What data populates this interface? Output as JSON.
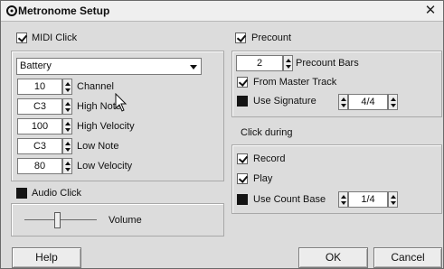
{
  "window": {
    "title": "Metronome Setup",
    "close_glyph": "✕"
  },
  "midi_click": {
    "label": "MIDI Click",
    "checked": true,
    "instrument": "Battery",
    "fields": [
      {
        "value": "10",
        "label": "Channel"
      },
      {
        "value": "C3",
        "label": "High Note"
      },
      {
        "value": "100",
        "label": "High Velocity"
      },
      {
        "value": "C3",
        "label": "Low Note"
      },
      {
        "value": "80",
        "label": "Low Velocity"
      }
    ]
  },
  "audio_click": {
    "label": "Audio Click",
    "checked": false,
    "volume_label": "Volume",
    "volume_level": 0.45
  },
  "precount": {
    "label": "Precount",
    "checked": true,
    "bars_value": "2",
    "bars_label": "Precount Bars",
    "from_master_track_label": "From Master Track",
    "from_master_track_checked": true,
    "use_signature_label": "Use Signature",
    "use_signature_checked": false,
    "signature_value": "4/4"
  },
  "click_during": {
    "label": "Click during",
    "record_label": "Record",
    "record_checked": true,
    "play_label": "Play",
    "play_checked": true,
    "use_count_base_label": "Use Count Base",
    "use_count_base_checked": false,
    "count_base_value": "1/4"
  },
  "buttons": {
    "help": "Help",
    "ok": "OK",
    "cancel": "Cancel"
  },
  "icons": {
    "title": "metronome-app-icon",
    "close": "close-icon",
    "dropdown": "chevron-down-icon",
    "spinner": "spinner-arrows-icon",
    "cursor": "mouse-pointer-icon"
  }
}
